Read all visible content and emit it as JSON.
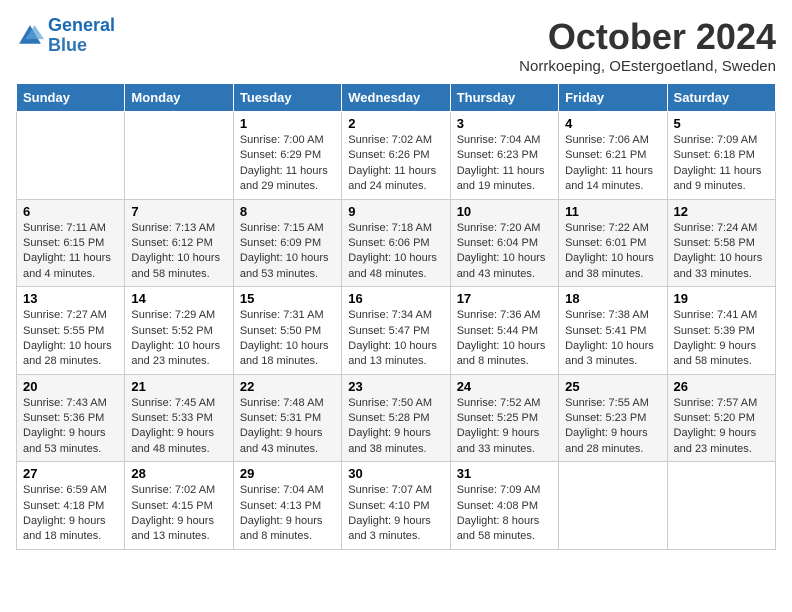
{
  "header": {
    "logo_line1": "General",
    "logo_line2": "Blue",
    "month": "October 2024",
    "location": "Norrkoeping, OEstergoetland, Sweden"
  },
  "days_of_week": [
    "Sunday",
    "Monday",
    "Tuesday",
    "Wednesday",
    "Thursday",
    "Friday",
    "Saturday"
  ],
  "weeks": [
    [
      {
        "day": "",
        "info": ""
      },
      {
        "day": "",
        "info": ""
      },
      {
        "day": "1",
        "info": "Sunrise: 7:00 AM\nSunset: 6:29 PM\nDaylight: 11 hours and 29 minutes."
      },
      {
        "day": "2",
        "info": "Sunrise: 7:02 AM\nSunset: 6:26 PM\nDaylight: 11 hours and 24 minutes."
      },
      {
        "day": "3",
        "info": "Sunrise: 7:04 AM\nSunset: 6:23 PM\nDaylight: 11 hours and 19 minutes."
      },
      {
        "day": "4",
        "info": "Sunrise: 7:06 AM\nSunset: 6:21 PM\nDaylight: 11 hours and 14 minutes."
      },
      {
        "day": "5",
        "info": "Sunrise: 7:09 AM\nSunset: 6:18 PM\nDaylight: 11 hours and 9 minutes."
      }
    ],
    [
      {
        "day": "6",
        "info": "Sunrise: 7:11 AM\nSunset: 6:15 PM\nDaylight: 11 hours and 4 minutes."
      },
      {
        "day": "7",
        "info": "Sunrise: 7:13 AM\nSunset: 6:12 PM\nDaylight: 10 hours and 58 minutes."
      },
      {
        "day": "8",
        "info": "Sunrise: 7:15 AM\nSunset: 6:09 PM\nDaylight: 10 hours and 53 minutes."
      },
      {
        "day": "9",
        "info": "Sunrise: 7:18 AM\nSunset: 6:06 PM\nDaylight: 10 hours and 48 minutes."
      },
      {
        "day": "10",
        "info": "Sunrise: 7:20 AM\nSunset: 6:04 PM\nDaylight: 10 hours and 43 minutes."
      },
      {
        "day": "11",
        "info": "Sunrise: 7:22 AM\nSunset: 6:01 PM\nDaylight: 10 hours and 38 minutes."
      },
      {
        "day": "12",
        "info": "Sunrise: 7:24 AM\nSunset: 5:58 PM\nDaylight: 10 hours and 33 minutes."
      }
    ],
    [
      {
        "day": "13",
        "info": "Sunrise: 7:27 AM\nSunset: 5:55 PM\nDaylight: 10 hours and 28 minutes."
      },
      {
        "day": "14",
        "info": "Sunrise: 7:29 AM\nSunset: 5:52 PM\nDaylight: 10 hours and 23 minutes."
      },
      {
        "day": "15",
        "info": "Sunrise: 7:31 AM\nSunset: 5:50 PM\nDaylight: 10 hours and 18 minutes."
      },
      {
        "day": "16",
        "info": "Sunrise: 7:34 AM\nSunset: 5:47 PM\nDaylight: 10 hours and 13 minutes."
      },
      {
        "day": "17",
        "info": "Sunrise: 7:36 AM\nSunset: 5:44 PM\nDaylight: 10 hours and 8 minutes."
      },
      {
        "day": "18",
        "info": "Sunrise: 7:38 AM\nSunset: 5:41 PM\nDaylight: 10 hours and 3 minutes."
      },
      {
        "day": "19",
        "info": "Sunrise: 7:41 AM\nSunset: 5:39 PM\nDaylight: 9 hours and 58 minutes."
      }
    ],
    [
      {
        "day": "20",
        "info": "Sunrise: 7:43 AM\nSunset: 5:36 PM\nDaylight: 9 hours and 53 minutes."
      },
      {
        "day": "21",
        "info": "Sunrise: 7:45 AM\nSunset: 5:33 PM\nDaylight: 9 hours and 48 minutes."
      },
      {
        "day": "22",
        "info": "Sunrise: 7:48 AM\nSunset: 5:31 PM\nDaylight: 9 hours and 43 minutes."
      },
      {
        "day": "23",
        "info": "Sunrise: 7:50 AM\nSunset: 5:28 PM\nDaylight: 9 hours and 38 minutes."
      },
      {
        "day": "24",
        "info": "Sunrise: 7:52 AM\nSunset: 5:25 PM\nDaylight: 9 hours and 33 minutes."
      },
      {
        "day": "25",
        "info": "Sunrise: 7:55 AM\nSunset: 5:23 PM\nDaylight: 9 hours and 28 minutes."
      },
      {
        "day": "26",
        "info": "Sunrise: 7:57 AM\nSunset: 5:20 PM\nDaylight: 9 hours and 23 minutes."
      }
    ],
    [
      {
        "day": "27",
        "info": "Sunrise: 6:59 AM\nSunset: 4:18 PM\nDaylight: 9 hours and 18 minutes."
      },
      {
        "day": "28",
        "info": "Sunrise: 7:02 AM\nSunset: 4:15 PM\nDaylight: 9 hours and 13 minutes."
      },
      {
        "day": "29",
        "info": "Sunrise: 7:04 AM\nSunset: 4:13 PM\nDaylight: 9 hours and 8 minutes."
      },
      {
        "day": "30",
        "info": "Sunrise: 7:07 AM\nSunset: 4:10 PM\nDaylight: 9 hours and 3 minutes."
      },
      {
        "day": "31",
        "info": "Sunrise: 7:09 AM\nSunset: 4:08 PM\nDaylight: 8 hours and 58 minutes."
      },
      {
        "day": "",
        "info": ""
      },
      {
        "day": "",
        "info": ""
      }
    ]
  ]
}
